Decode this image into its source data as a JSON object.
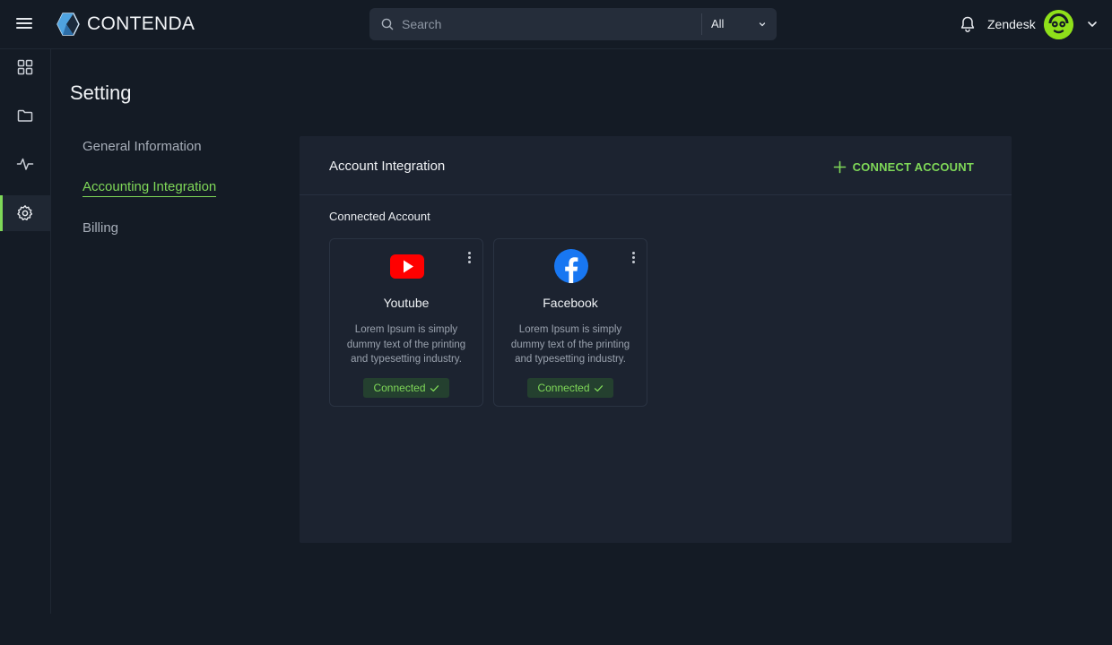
{
  "header": {
    "brand": "CONTENDA",
    "search": {
      "placeholder": "Search",
      "filter_value": "All"
    },
    "user_name": "Zendesk"
  },
  "rail": {
    "items": [
      {
        "icon": "grid-icon"
      },
      {
        "icon": "folder-icon"
      },
      {
        "icon": "activity-icon"
      },
      {
        "icon": "gear-icon",
        "active": true
      }
    ]
  },
  "page": {
    "title": "Setting",
    "nav": [
      {
        "label": "General Information"
      },
      {
        "label": "Accounting Integration",
        "active": true
      },
      {
        "label": "Billing"
      }
    ]
  },
  "panel": {
    "title": "Account Integration",
    "connect_label": "CONNECT ACCOUNT",
    "section_label": "Connected Account",
    "cards": [
      {
        "name": "Youtube",
        "icon": "youtube-icon",
        "description": "Lorem Ipsum is simply dummy text of the printing and typesetting industry.",
        "status": "Connected"
      },
      {
        "name": "Facebook",
        "icon": "facebook-icon",
        "description": "Lorem Ipsum is simply dummy text of the printing and typesetting industry.",
        "status": "Connected"
      }
    ]
  },
  "colors": {
    "accent": "#7fd858",
    "background": "#141b25",
    "panel": "#1c2330",
    "youtube_red": "#ff0000",
    "facebook_blue": "#1877f2",
    "avatar": "#8fe01a"
  }
}
